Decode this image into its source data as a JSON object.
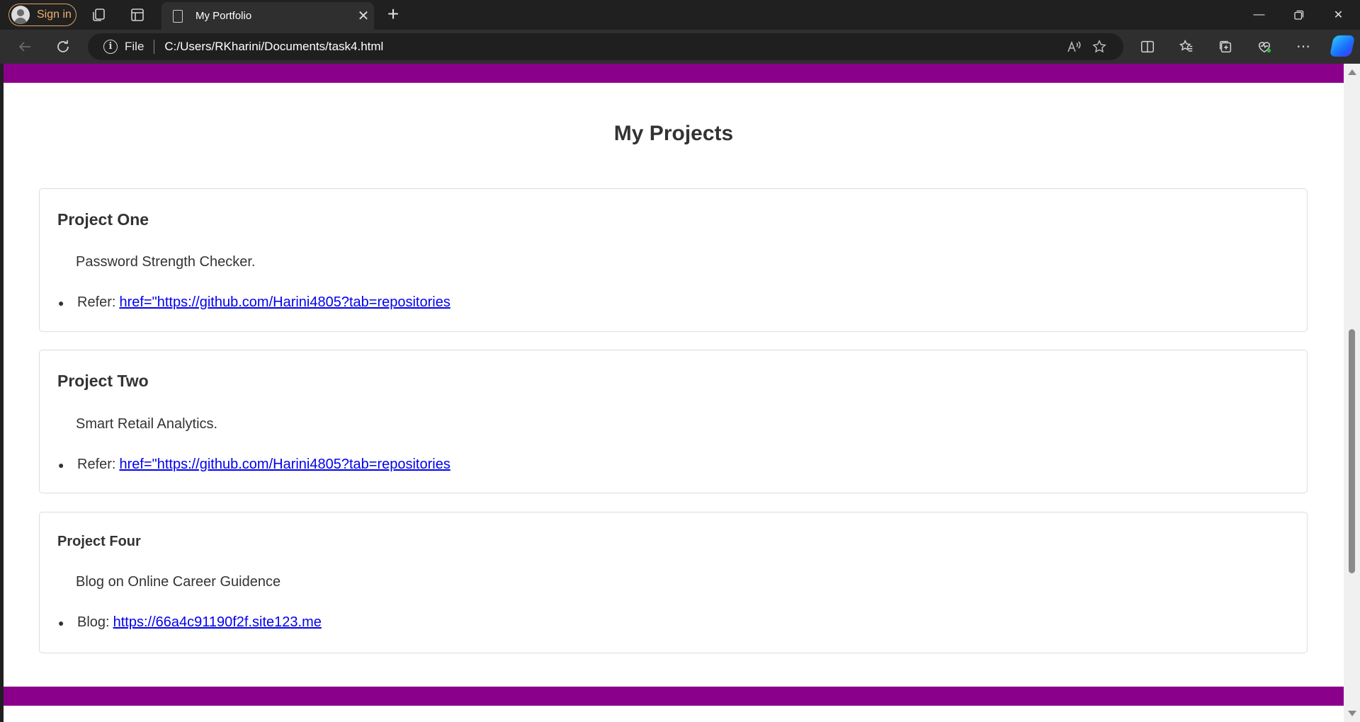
{
  "browser": {
    "sign_in_label": "Sign in",
    "tab_title": "My Portfolio",
    "address": {
      "protocol": "File",
      "url": "C:/Users/RKharini/Documents/task4.html"
    }
  },
  "page": {
    "heading": "My Projects",
    "accent_color": "#8b008b",
    "projects": [
      {
        "title": "Project One",
        "description": "Password Strength Checker.",
        "link_prefix": "Refer:",
        "link_text": "href=\"https://github.com/Harini4805?tab=repositories"
      },
      {
        "title": "Project Two",
        "description": "Smart Retail Analytics.",
        "link_prefix": "Refer:",
        "link_text": "href=\"https://github.com/Harini4805?tab=repositories"
      },
      {
        "title": "Project Four",
        "description": "Blog on Online Career Guidence",
        "link_prefix": "Blog:",
        "link_text": "https://66a4c91190f2f.site123.me"
      }
    ]
  }
}
